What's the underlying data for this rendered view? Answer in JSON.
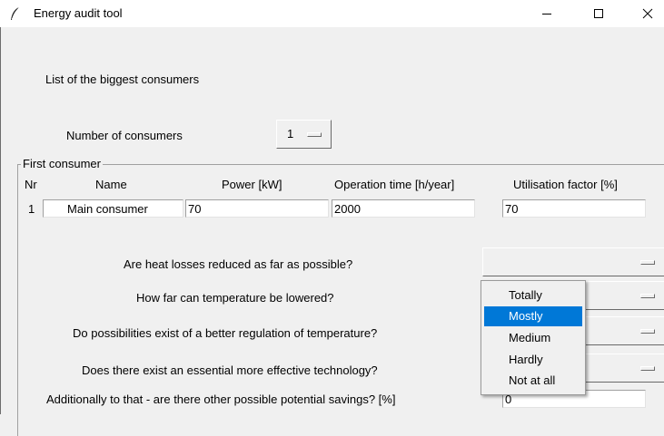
{
  "window": {
    "title": "Energy audit tool",
    "minimize": "—",
    "maximize": "☐",
    "close": "✕"
  },
  "heading": "List of the biggest consumers",
  "count": {
    "label": "Number of consumers",
    "value": "1"
  },
  "group": {
    "label": "First consumer"
  },
  "table": {
    "headers": {
      "nr": "Nr",
      "name": "Name",
      "power": "Power [kW]",
      "time": "Operation time [h/year]",
      "util": "Utilisation factor [%]"
    },
    "row": {
      "nr": "1",
      "name": "Main consumer",
      "power": "70",
      "time": "2000",
      "util": "70"
    }
  },
  "questions": {
    "q1": "Are heat losses reduced as far as possible?",
    "q2": "How far can temperature be lowered?",
    "q3": "Do possibilities exist of a better regulation of temperature?",
    "q4": "Does there exist an essential more effective technology?",
    "q5": "Additionally to that - are there other possible potential savings? [%]",
    "q5_value": "0"
  },
  "dropdown": {
    "options": [
      "Totally",
      "Mostly",
      "Medium",
      "Hardly",
      "Not at all"
    ],
    "highlighted": "Mostly"
  },
  "colors": {
    "highlight": "#0078d7",
    "background": "#f0f0f0"
  }
}
